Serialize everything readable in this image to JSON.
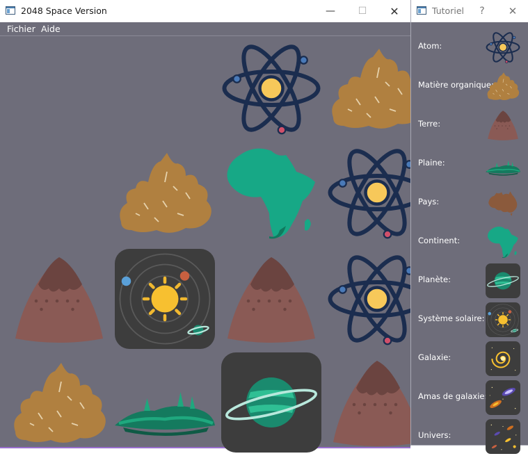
{
  "main_window": {
    "title": "2048 Space Version",
    "controls": {
      "minimize": "—",
      "maximize": "☐",
      "close": "✕"
    },
    "menu": [
      "Fichier",
      "Aide"
    ]
  },
  "board": {
    "rows": [
      [
        "empty",
        "empty",
        "atom",
        "organic-matter"
      ],
      [
        "empty",
        "organic-matter",
        "continent",
        "atom"
      ],
      [
        "earth",
        "solar-system",
        "earth",
        "atom"
      ],
      [
        "organic-matter",
        "plain",
        "planet",
        "earth"
      ]
    ]
  },
  "tutorial_window": {
    "title": "Tutoriel",
    "controls": {
      "help": "?",
      "close": "✕"
    },
    "items": [
      {
        "label": "Atom:",
        "icon": "atom"
      },
      {
        "label": "Matière organique:",
        "icon": "organic-matter"
      },
      {
        "label": "Terre:",
        "icon": "earth"
      },
      {
        "label": "Plaine:",
        "icon": "plain"
      },
      {
        "label": "Pays:",
        "icon": "country"
      },
      {
        "label": "Continent:",
        "icon": "continent"
      },
      {
        "label": "Planète:",
        "icon": "planet"
      },
      {
        "label": "Système solaire:",
        "icon": "solar-system"
      },
      {
        "label": "Galaxie:",
        "icon": "galaxy"
      },
      {
        "label": "Amas de galaxie:",
        "icon": "galaxy-cluster"
      },
      {
        "label": "Univers:",
        "icon": "universe"
      }
    ]
  },
  "colors": {
    "board_background": "#6e6d7a",
    "atom_navy": "#1b2d4f",
    "atom_nucleus": "#f7c85a",
    "organic_brown": "#b08040",
    "earth_brown": "#8a5a55",
    "earth_top": "#6b4440",
    "continent_green": "#17a886",
    "tile_dark": "#3d3d3d",
    "window_accent": "#9a6fcf"
  }
}
